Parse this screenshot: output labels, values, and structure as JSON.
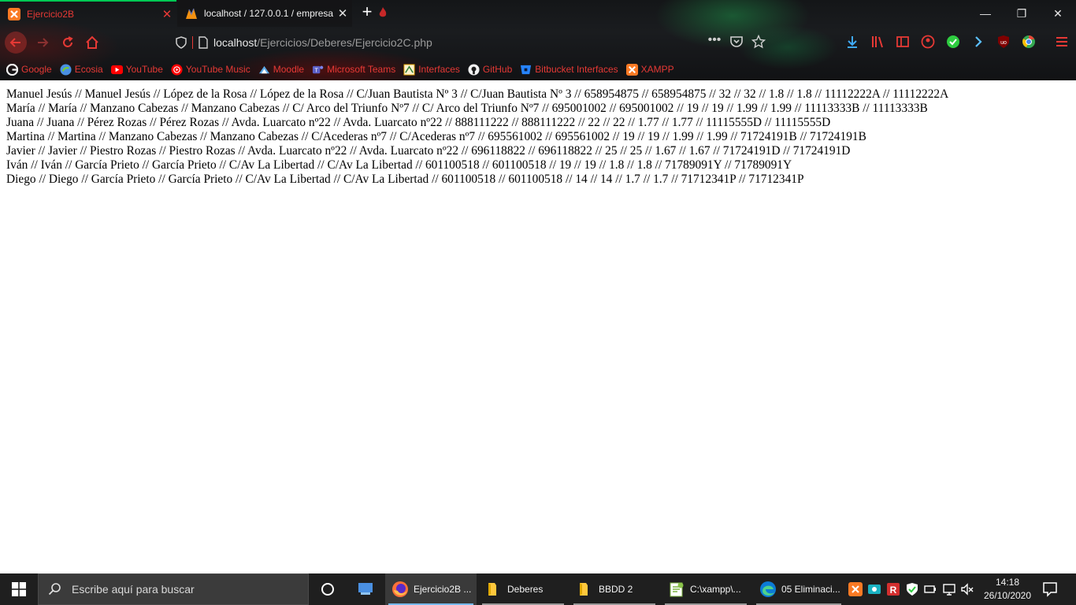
{
  "browser": {
    "tabs": [
      {
        "label": "Ejercicio2B",
        "icon": "xampp-icon",
        "color": "#e53935"
      },
      {
        "label": "localhost / 127.0.0.1 / empresa",
        "icon": "phpmyadmin-icon",
        "color": "#f1f1f1"
      }
    ],
    "new_tab_label": "+",
    "url_host": "localhost",
    "url_path": "/Ejercicios/Deberes/Ejercicio2C.php",
    "bookmarks": [
      {
        "label": "Google",
        "icon": "google-icon"
      },
      {
        "label": "Ecosia",
        "icon": "ecosia-icon"
      },
      {
        "label": "YouTube",
        "icon": "youtube-icon"
      },
      {
        "label": "YouTube Music",
        "icon": "youtube-music-icon"
      },
      {
        "label": "Moodle",
        "icon": "moodle-icon"
      },
      {
        "label": "Microsoft Teams",
        "icon": "teams-icon"
      },
      {
        "label": "Interfaces",
        "icon": "interfaces-icon"
      },
      {
        "label": "GitHub",
        "icon": "github-icon"
      },
      {
        "label": "Bitbucket Interfaces",
        "icon": "bitbucket-icon"
      },
      {
        "label": "XAMPP",
        "icon": "xampp-icon"
      }
    ]
  },
  "page": {
    "records": [
      "Manuel Jesús // Manuel Jesús // López de la Rosa // López de la Rosa // C/Juan Bautista Nº 3 // C/Juan Bautista Nº 3 // 658954875 // 658954875 // 32 // 32 // 1.8 // 1.8 // 11112222A // 11112222A",
      "María // María // Manzano Cabezas // Manzano Cabezas // C/ Arco del Triunfo Nº7 // C/ Arco del Triunfo Nº7 // 695001002 // 695001002 // 19 // 19 // 1.99 // 1.99 // 11113333B // 11113333B",
      "Juana // Juana // Pérez Rozas // Pérez Rozas // Avda. Luarcato nº22 // Avda. Luarcato nº22 // 888111222 // 888111222 // 22 // 22 // 1.77 // 1.77 // 11115555D // 11115555D",
      "Martina // Martina // Manzano Cabezas // Manzano Cabezas // C/Acederas nº7 // C/Acederas nº7 // 695561002 // 695561002 // 19 // 19 // 1.99 // 1.99 // 71724191B // 71724191B",
      "Javier // Javier // Piestro Rozas // Piestro Rozas // Avda. Luarcato nº22 // Avda. Luarcato nº22 // 696118822 // 696118822 // 25 // 25 // 1.67 // 1.67 // 71724191D // 71724191D",
      "Iván // Iván // García Prieto // García Prieto // C/Av La Libertad // C/Av La Libertad // 601100518 // 601100518 // 19 // 19 // 1.8 // 1.8 // 71789091Y // 71789091Y",
      "Diego // Diego // García Prieto // García Prieto // C/Av La Libertad // C/Av La Libertad // 601100518 // 601100518 // 14 // 14 // 1.7 // 1.7 // 71712341P // 71712341P"
    ]
  },
  "taskbar": {
    "search_placeholder": "Escribe aquí para buscar",
    "apps": [
      {
        "label": "Ejercicio2B ...",
        "icon": "firefox-icon"
      },
      {
        "label": "Deberes",
        "icon": "folder-icon"
      },
      {
        "label": "BBDD 2",
        "icon": "folder-icon"
      },
      {
        "label": "C:\\xampp\\...",
        "icon": "notepad-plus-icon"
      },
      {
        "label": "05 Eliminaci...",
        "icon": "edge-icon"
      }
    ],
    "clock_time": "14:18",
    "clock_date": "26/10/2020"
  },
  "colors": {
    "accent_red": "#e53935",
    "tab_indicator_green": "#00c853",
    "taskbar_bg": "#1f1f1f"
  }
}
